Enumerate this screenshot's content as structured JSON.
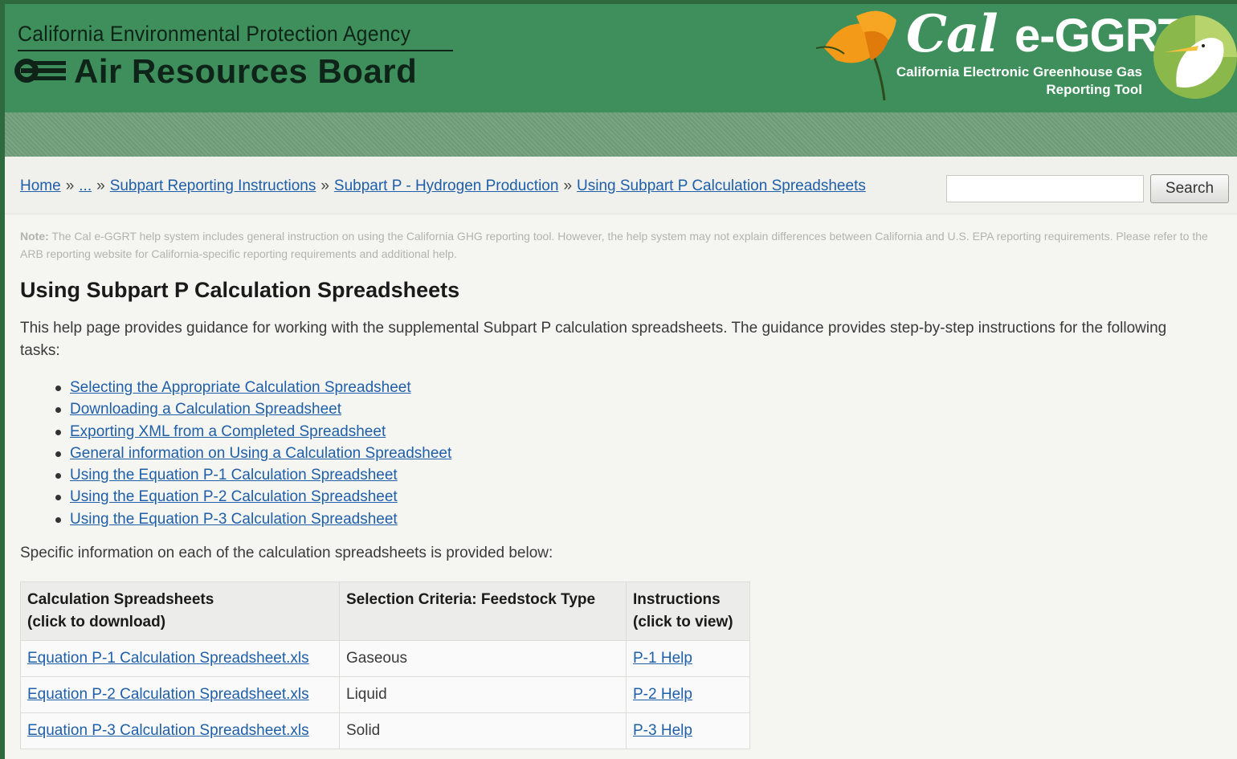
{
  "header": {
    "agency": "California Environmental Protection Agency",
    "board": "Air Resources Board",
    "brand_name_a": "Cal",
    "brand_name_b": "e-GGRT",
    "brand_sub_1": "California Electronic Greenhouse Gas",
    "brand_sub_2": "Reporting Tool"
  },
  "breadcrumb": {
    "items": [
      "Home",
      "...",
      "Subpart Reporting Instructions",
      "Subpart P - Hydrogen Production",
      "Using Subpart P Calculation Spreadsheets"
    ],
    "separator": "»"
  },
  "search": {
    "placeholder": "",
    "button_label": "Search"
  },
  "note": {
    "label": "Note:",
    "text": "The Cal e-GGRT help system includes general instruction on using the California GHG reporting tool. However, the help system may not explain differences between California and U.S. EPA reporting requirements. Please refer to the ARB reporting website for California-specific reporting requirements and additional help."
  },
  "page": {
    "title": "Using Subpart P Calculation Spreadsheets",
    "intro": "This help page provides guidance for working with the supplemental Subpart P calculation spreadsheets. The guidance provides step-by-step instructions for the following tasks:",
    "tasks": [
      "Selecting the Appropriate Calculation Spreadsheet",
      "Downloading a Calculation Spreadsheet",
      "Exporting XML from a Completed Spreadsheet",
      "General information on Using a Calculation Spreadsheet",
      "Using the Equation P-1 Calculation Spreadsheet",
      "Using the Equation P-2 Calculation Spreadsheet",
      "Using the Equation P-3 Calculation Spreadsheet"
    ],
    "specific": "Specific information on each of the calculation spreadsheets is provided below:"
  },
  "table": {
    "headers": [
      [
        "Calculation Spreadsheets",
        "(click to download)"
      ],
      [
        "Selection Criteria: Feedstock Type"
      ],
      [
        "Instructions",
        "(click to view)"
      ]
    ],
    "rows": [
      {
        "spreadsheet": "Equation P-1 Calculation Spreadsheet.xls",
        "feedstock": "Gaseous",
        "help": "P-1 Help"
      },
      {
        "spreadsheet": "Equation P-2 Calculation Spreadsheet.xls",
        "feedstock": "Liquid",
        "help": "P-2 Help"
      },
      {
        "spreadsheet": "Equation P-3 Calculation Spreadsheet.xls",
        "feedstock": "Solid",
        "help": "P-3 Help"
      }
    ]
  },
  "colors": {
    "header_green": "#3f8f5c",
    "link_blue": "#1f5fa8",
    "poppy_orange": "#f08a12"
  },
  "icons": [
    "arb-logo-icon",
    "poppy-flower-icon",
    "egret-bird-icon"
  ]
}
